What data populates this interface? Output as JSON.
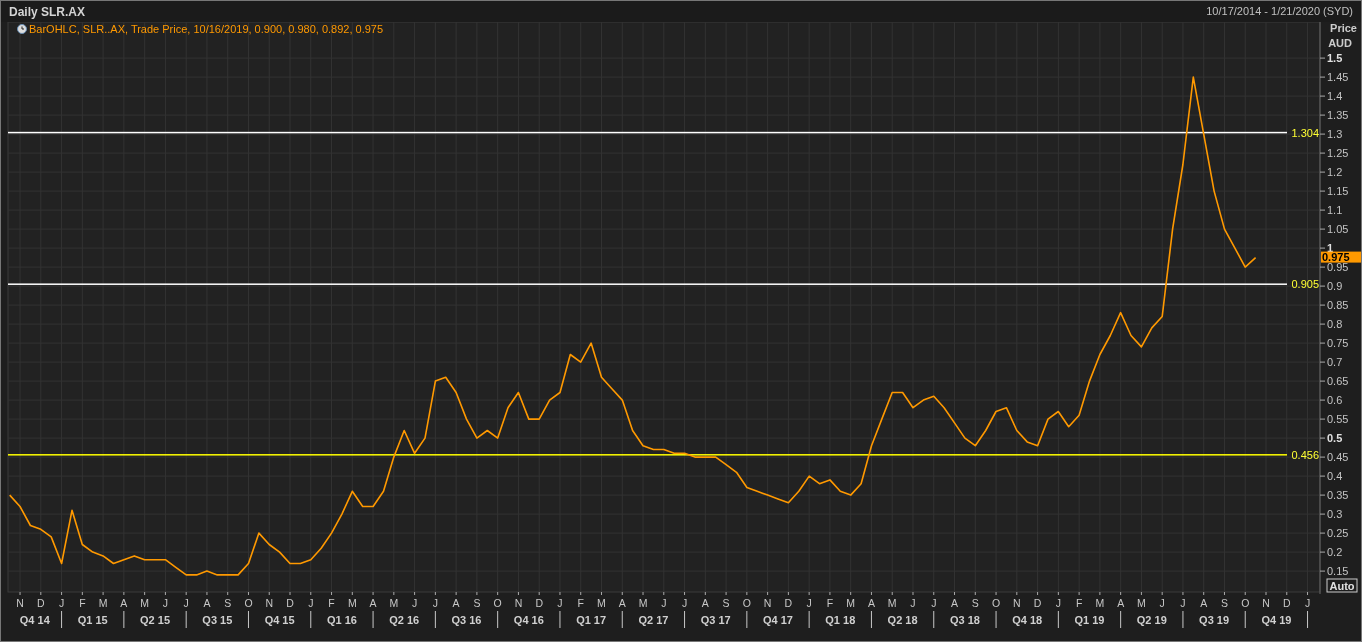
{
  "window": {
    "title": "Daily SLR.AX",
    "date_range": "10/17/2014 - 1/21/2020 (SYD)"
  },
  "chart": {
    "legend": "BarOHLC, SLR..AX, Trade Price, 10/16/2019, 0.900, 0.980, 0.892, 0.975",
    "axis_title": [
      "Price",
      "AUD"
    ],
    "last_price": "0.975",
    "scale_button": "Auto",
    "quarters": [
      "Q4 14",
      "Q1 15",
      "Q2 15",
      "Q3 15",
      "Q4 15",
      "Q1 16",
      "Q2 16",
      "Q3 16",
      "Q4 16",
      "Q1 17",
      "Q2 17",
      "Q3 17",
      "Q4 17",
      "Q1 18",
      "Q2 18",
      "Q3 18",
      "Q4 18",
      "Q1 19",
      "Q2 19",
      "Q3 19",
      "Q4 19"
    ],
    "chart_data": {
      "type": "line",
      "grid": true,
      "ref_lines": [
        {
          "axis": "y",
          "value": 1.304,
          "label": "1.304",
          "color": "#ffffff"
        },
        {
          "axis": "y",
          "value": 0.905,
          "label": "0.905",
          "color": "#ffffff"
        },
        {
          "axis": "y",
          "value": 0.456,
          "label": "0.456",
          "color": "#ffff00"
        }
      ],
      "categories": [
        null,
        "N",
        null,
        "D",
        null,
        "J",
        null,
        "F",
        null,
        "M",
        null,
        "A",
        null,
        "M",
        null,
        "J",
        null,
        "J",
        null,
        "A",
        null,
        "S",
        null,
        "O",
        null,
        "N",
        null,
        "D",
        null,
        "J",
        null,
        "F",
        null,
        "M",
        null,
        "A",
        null,
        "M",
        null,
        "J",
        null,
        "J",
        null,
        "A",
        null,
        "S",
        null,
        "O",
        null,
        "N",
        null,
        "D",
        null,
        "J",
        null,
        "F",
        null,
        "M",
        null,
        "A",
        null,
        "M",
        null,
        "J",
        null,
        "J",
        null,
        "A",
        null,
        "S",
        null,
        "O",
        null,
        "N",
        null,
        "D",
        null,
        "J",
        null,
        "F",
        null,
        "M",
        null,
        "A",
        null,
        "M",
        null,
        "J",
        null,
        "J",
        null,
        "A",
        null,
        "S",
        null,
        "O",
        null,
        "N",
        null,
        "D",
        null,
        "J",
        null,
        "F",
        null,
        "M",
        null,
        "A",
        null,
        "M",
        null,
        "J",
        null,
        "J",
        null,
        "A",
        null,
        "S",
        null,
        "O",
        null,
        "N",
        null,
        "D",
        null,
        "J"
      ],
      "series": [
        {
          "color": "#ff9900",
          "values": [
            0.35,
            0.32,
            0.27,
            0.26,
            0.24,
            0.17,
            0.31,
            0.22,
            0.2,
            0.19,
            0.17,
            0.18,
            0.19,
            0.18,
            0.18,
            0.18,
            0.16,
            0.14,
            0.14,
            0.15,
            0.14,
            0.14,
            0.14,
            0.17,
            0.25,
            0.22,
            0.2,
            0.17,
            0.17,
            0.18,
            0.21,
            0.25,
            0.3,
            0.36,
            0.32,
            0.32,
            0.36,
            0.45,
            0.52,
            0.46,
            0.5,
            0.65,
            0.66,
            0.62,
            0.55,
            0.5,
            0.52,
            0.5,
            0.58,
            0.62,
            0.55,
            0.55,
            0.6,
            0.62,
            0.72,
            0.7,
            0.75,
            0.66,
            0.63,
            0.6,
            0.52,
            0.48,
            0.47,
            0.47,
            0.46,
            0.46,
            0.45,
            0.45,
            0.45,
            0.43,
            0.41,
            0.37,
            0.36,
            0.35,
            0.34,
            0.33,
            0.36,
            0.4,
            0.38,
            0.39,
            0.36,
            0.35,
            0.38,
            0.48,
            0.55,
            0.62,
            0.62,
            0.58,
            0.6,
            0.61,
            0.58,
            0.54,
            0.5,
            0.48,
            0.52,
            0.57,
            0.58,
            0.52,
            0.49,
            0.48,
            0.55,
            0.57,
            0.53,
            0.56,
            0.65,
            0.72,
            0.77,
            0.83,
            0.77,
            0.74,
            0.79,
            0.82,
            1.05,
            1.22,
            1.45,
            1.3,
            1.15,
            1.05,
            1.0,
            0.95,
            0.975,
            null,
            null,
            null,
            null,
            null
          ]
        }
      ],
      "ylim": [
        0.095,
        1.595
      ],
      "yticks": [
        {
          "value": 0.15,
          "label": "0.15"
        },
        {
          "value": 0.2,
          "label": "0.2"
        },
        {
          "value": 0.25,
          "label": "0.25"
        },
        {
          "value": 0.3,
          "label": "0.3"
        },
        {
          "value": 0.35,
          "label": "0.35"
        },
        {
          "value": 0.4,
          "label": "0.4"
        },
        {
          "value": 0.45,
          "label": "0.45"
        },
        {
          "value": 0.5,
          "label": "0.5"
        },
        {
          "value": 0.55,
          "label": "0.55"
        },
        {
          "value": 0.6,
          "label": "0.6"
        },
        {
          "value": 0.65,
          "label": "0.65"
        },
        {
          "value": 0.7,
          "label": "0.7"
        },
        {
          "value": 0.75,
          "label": "0.75"
        },
        {
          "value": 0.8,
          "label": "0.8"
        },
        {
          "value": 0.85,
          "label": "0.85"
        },
        {
          "value": 0.9,
          "label": "0.9"
        },
        {
          "value": 0.95,
          "label": "0.95"
        },
        {
          "value": 1,
          "label": "1"
        },
        {
          "value": 1.05,
          "label": "1.05"
        },
        {
          "value": 1.1,
          "label": "1.1"
        },
        {
          "value": 1.15,
          "label": "1.15"
        },
        {
          "value": 1.2,
          "label": "1.2"
        },
        {
          "value": 1.25,
          "label": "1.25"
        },
        {
          "value": 1.3,
          "label": "1.3"
        },
        {
          "value": 1.35,
          "label": "1.35"
        },
        {
          "value": 1.4,
          "label": "1.4"
        },
        {
          "value": 1.45,
          "label": "1.45"
        },
        {
          "value": 1.5,
          "label": "1.5"
        }
      ]
    }
  }
}
